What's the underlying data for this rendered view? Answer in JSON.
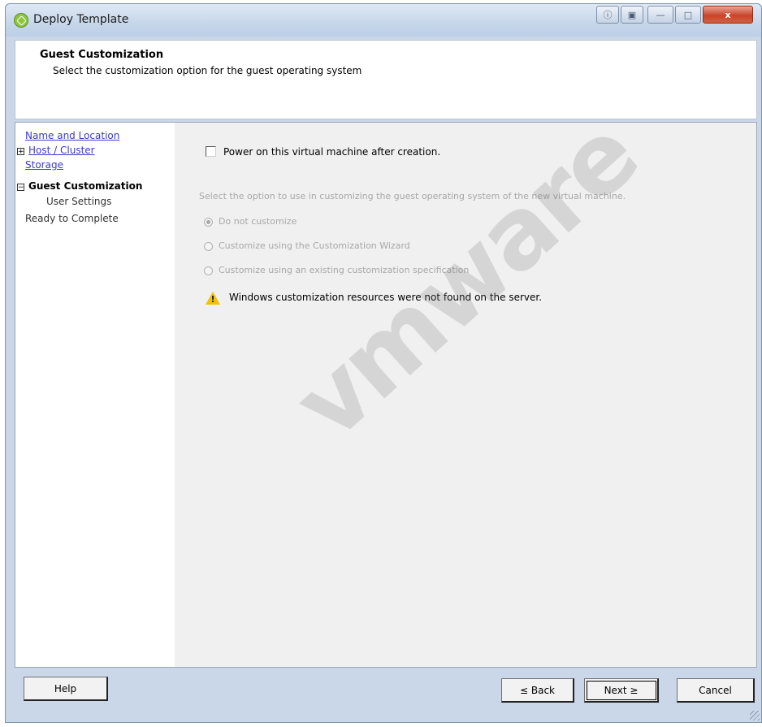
{
  "window": {
    "title": "Deploy Template",
    "controls": [
      "ⓘ",
      "▣",
      "—",
      "□",
      "x"
    ]
  },
  "header": {
    "title": "Guest Customization",
    "subtitle": "Select the customization option for the guest operating system"
  },
  "nav": {
    "items": [
      {
        "label": "Name and Location"
      },
      {
        "label": "Host / Cluster",
        "toggle": "+"
      },
      {
        "label": "Storage"
      },
      {
        "label": "Guest Customization",
        "toggle": "−"
      },
      {
        "label": "User Settings"
      },
      {
        "label": "Ready to Complete"
      }
    ]
  },
  "main": {
    "power_on_label": "Power on this virtual machine after creation.",
    "power_on_checked": false,
    "instruction": "Select the option to use in customizing the guest operating system of the new virtual machine.",
    "options": [
      {
        "label": "Do not customize",
        "selected": true
      },
      {
        "label": "Customize using the Customization Wizard",
        "selected": false
      },
      {
        "label": "Customize using an existing customization specification",
        "selected": false
      }
    ],
    "warning": "Windows customization resources were not found on the server.",
    "watermark": "vmware"
  },
  "footer": {
    "help": "Help",
    "back": "≤ Back",
    "next": "Next ≥",
    "cancel": "Cancel"
  },
  "colors": {
    "link": "#3b3bc8",
    "disabled": "#a8a8a8",
    "warning": "#f2c200",
    "close_button": "#c8452c"
  }
}
